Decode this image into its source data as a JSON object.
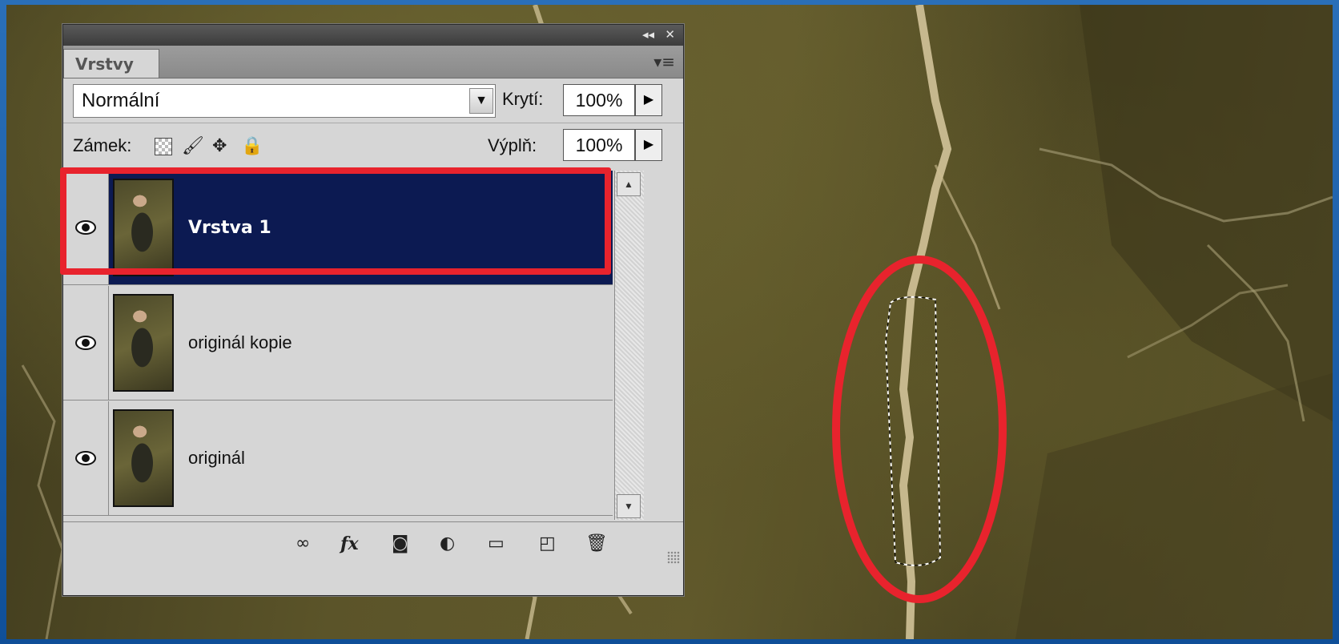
{
  "panel": {
    "tab_label": "Vrstvy",
    "collapse_glyph": "◂◂",
    "close_glyph": "✕",
    "menu_glyph": "▾≡",
    "blend_mode": "Normální",
    "opacity_label": "Krytí:",
    "opacity_value": "100%",
    "lock_label": "Zámek:",
    "fill_label": "Výplň:",
    "fill_value": "100%",
    "lock_icons": [
      "lock-transparent-icon",
      "brush-icon",
      "move-icon",
      "lock-icon"
    ],
    "layers": [
      {
        "name": "Vrstva 1",
        "active": true,
        "visible": true
      },
      {
        "name": "originál kopie",
        "active": false,
        "visible": true
      },
      {
        "name": "originál",
        "active": false,
        "visible": true
      }
    ],
    "bottom_icons": [
      "link-icon",
      "fx-icon",
      "mask-icon",
      "adjustment-icon",
      "folder-icon",
      "new-layer-icon",
      "trash-icon"
    ]
  },
  "colors": {
    "highlight": "#e8232d",
    "active_layer": "#0c1a52",
    "panel_bg": "#d6d6d6"
  }
}
